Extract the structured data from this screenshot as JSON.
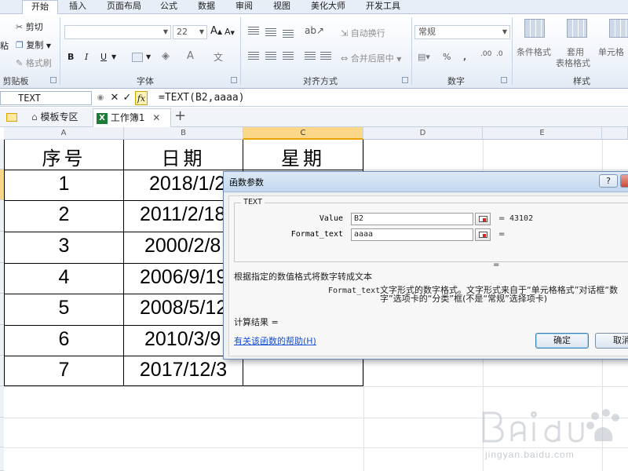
{
  "ribbon": {
    "tabs": [
      {
        "label": "开始",
        "active": true
      },
      {
        "label": "插入"
      },
      {
        "label": "页面布局"
      },
      {
        "label": "公式"
      },
      {
        "label": "数据"
      },
      {
        "label": "审阅"
      },
      {
        "label": "视图"
      },
      {
        "label": "美化大师"
      },
      {
        "label": "开发工具"
      }
    ],
    "clipboard": {
      "paste": "粘",
      "cut": "剪切",
      "copy": "复制",
      "format_painter": "格式刷",
      "label": "剪贴板"
    },
    "font": {
      "name": "",
      "size": "22",
      "bold": "B",
      "italic": "I",
      "underline": "U",
      "font_color": "A",
      "label": "字体"
    },
    "alignment": {
      "wrap": "自动换行",
      "merge": "合并后居中",
      "label": "对齐方式"
    },
    "number": {
      "format": "常规",
      "percent": "%",
      "comma": ",",
      "label": "数字"
    },
    "styles": {
      "conditional": "条件格式",
      "table_format_line1": "套用",
      "table_format_line2": "表格格式",
      "cell_styles": "单元格",
      "label": "样式"
    }
  },
  "formula_bar": {
    "name_box": "TEXT",
    "cancel": "✕",
    "enter": "✓",
    "fx": "fx",
    "formula": "=TEXT(B2,aaaa)"
  },
  "workbook_tabs": {
    "template": "模板专区",
    "workbook": "工作簿1",
    "close": "✕",
    "add": "+"
  },
  "sheet": {
    "columns": [
      "A",
      "B",
      "C",
      "D",
      "E"
    ],
    "selected_column": "C",
    "headers": [
      "序号",
      "日期",
      "星期"
    ],
    "rows": [
      {
        "no": "1",
        "date": "2018/1/2"
      },
      {
        "no": "2",
        "date": "2011/2/18"
      },
      {
        "no": "3",
        "date": "2000/2/8"
      },
      {
        "no": "4",
        "date": "2006/9/19"
      },
      {
        "no": "5",
        "date": "2008/5/12"
      },
      {
        "no": "6",
        "date": "2010/3/9"
      },
      {
        "no": "7",
        "date": "2017/12/3"
      }
    ]
  },
  "dialog": {
    "title": "函数参数",
    "help_btn": "?",
    "function_name": "TEXT",
    "args": [
      {
        "label": "Value",
        "value": "B2",
        "result": "43102"
      },
      {
        "label": "Format_text",
        "value": "aaaa",
        "result": ""
      }
    ],
    "eq": "=",
    "description": "根据指定的数值格式将数字转成文本",
    "arg_name": "Format_text",
    "arg_desc": "文字形式的数字格式。文字形式来自于“单元格格式”对话框“数字”选项卡的“分类”框(不是“常规”选择项卡)",
    "result_label": "计算结果 =",
    "help_link": "有关该函数的帮助(H)",
    "ok": "确定",
    "cancel": "取消"
  },
  "watermark": {
    "text": "jingyan.baidu.com"
  }
}
